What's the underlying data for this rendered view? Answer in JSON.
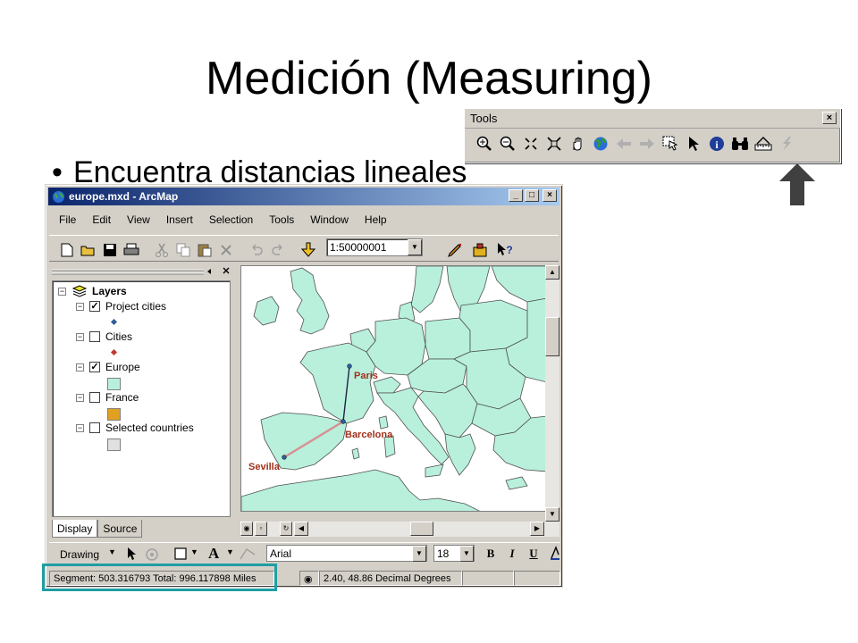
{
  "slide": {
    "title": "Medición (Measuring)",
    "bullet": "Encuentra distancias lineales"
  },
  "tools_toolbar": {
    "title": "Tools",
    "close": "×",
    "icons": [
      "zoom-in-icon",
      "zoom-out-icon",
      "fixed-zoom-in-icon",
      "fixed-zoom-out-icon",
      "pan-icon",
      "full-extent-icon",
      "back-extent-icon",
      "forward-extent-icon",
      "select-features-icon",
      "select-elements-icon",
      "identify-icon",
      "find-icon",
      "measure-icon",
      "hyperlink-icon"
    ]
  },
  "window": {
    "title": "europe.mxd - ArcMap",
    "buttons": {
      "minimize": "_",
      "maximize": "□",
      "close": "×"
    }
  },
  "menu": [
    "File",
    "Edit",
    "View",
    "Insert",
    "Selection",
    "Tools",
    "Window",
    "Help"
  ],
  "standard_toolbar": {
    "scale": "1:50000001",
    "icons": [
      "new-icon",
      "open-icon",
      "save-icon",
      "print-icon",
      "cut-icon",
      "copy-icon",
      "paste-icon",
      "delete-icon",
      "undo-icon",
      "redo-icon",
      "add-data-icon",
      "editor-icon",
      "arctoolbox-icon",
      "whats-this-icon"
    ]
  },
  "toc": {
    "root": "Layers",
    "layers": [
      {
        "name": "Project cities",
        "checked": true,
        "symbol": "point",
        "color": "#2f5f9a"
      },
      {
        "name": "Cities",
        "checked": false,
        "symbol": "point",
        "color": "#c0392b"
      },
      {
        "name": "Europe",
        "checked": true,
        "symbol": "fill",
        "color": "#b8f0dc"
      },
      {
        "name": "France",
        "checked": false,
        "symbol": "fill",
        "color": "#e0a020"
      },
      {
        "name": "Selected countries",
        "checked": false,
        "symbol": "fill",
        "color": "#e0e0e0"
      }
    ],
    "tabs": [
      "Display",
      "Source"
    ]
  },
  "map": {
    "land_color": "#b8f0dc",
    "cities": [
      "Paris",
      "Barcelona",
      "Sevilla"
    ],
    "city_label_color": "#a0301a"
  },
  "draw_toolbar": {
    "drawing": "Drawing",
    "font": "Arial",
    "size": "18",
    "bold": "B",
    "italic": "I",
    "underline": "U"
  },
  "status": {
    "measure": "Segment: 503.316793  Total: 996.117898  Miles",
    "coordinates": "2.40, 48.86 Decimal Degrees"
  },
  "colors": {
    "highlight": "#1f9ea3",
    "titlebar": "#0a246a"
  }
}
